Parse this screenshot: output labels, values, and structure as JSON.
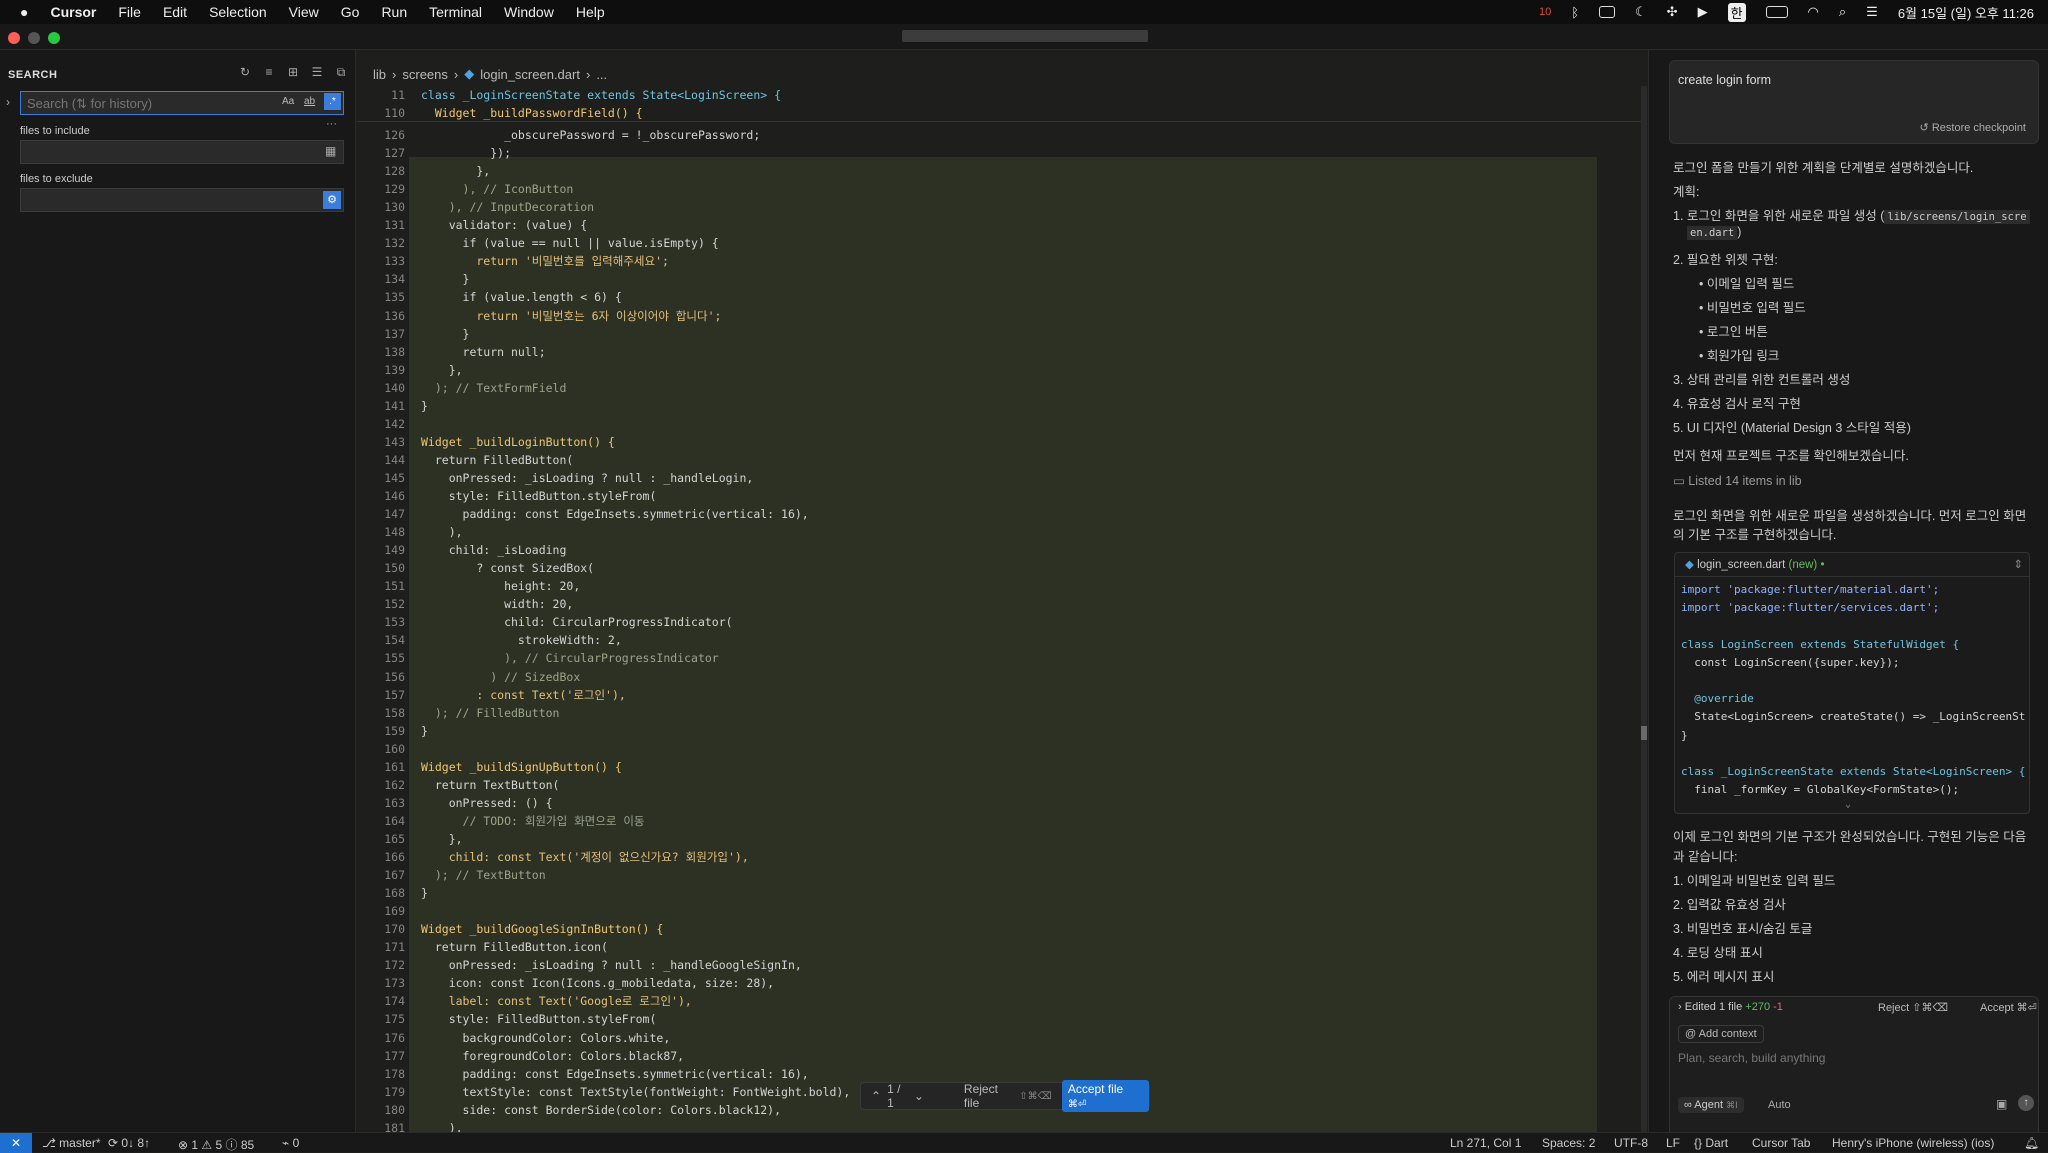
{
  "menubar": {
    "app": "Cursor",
    "items": [
      "File",
      "Edit",
      "Selection",
      "View",
      "Go",
      "Run",
      "Terminal",
      "Window",
      "Help"
    ],
    "clock": "6월 15일 (일) 오후 11:26",
    "input_source": "한",
    "notif_badge": "10"
  },
  "sidebar": {
    "title": "SEARCH",
    "search_placeholder": "Search (⇅ for history)",
    "match_case": "Aa",
    "whole_word": "ab",
    "regex": ".*",
    "include_label": "files to include",
    "exclude_label": "files to exclude",
    "more": "···"
  },
  "editor": {
    "breadcrumb": [
      "lib",
      "screens",
      "login_screen.dart",
      "..."
    ],
    "sticky": [
      {
        "n": "11",
        "t": "class _LoginScreenState extends State<LoginScreen> {"
      },
      {
        "n": "110",
        "t": "  Widget _buildPasswordField() {"
      }
    ],
    "lines": [
      {
        "n": "126",
        "t": "            _obscurePassword = !_obscurePassword;"
      },
      {
        "n": "127",
        "t": "          });"
      },
      {
        "n": "128",
        "t": "        },"
      },
      {
        "n": "129",
        "t": "      ), // IconButton"
      },
      {
        "n": "130",
        "t": "    ), // InputDecoration"
      },
      {
        "n": "131",
        "t": "    validator: (value) {"
      },
      {
        "n": "132",
        "t": "      if (value == null || value.isEmpty) {"
      },
      {
        "n": "133",
        "t": "        return '비밀번호를 입력해주세요';"
      },
      {
        "n": "134",
        "t": "      }"
      },
      {
        "n": "135",
        "t": "      if (value.length < 6) {"
      },
      {
        "n": "136",
        "t": "        return '비밀번호는 6자 이상이어야 합니다';"
      },
      {
        "n": "137",
        "t": "      }"
      },
      {
        "n": "138",
        "t": "      return null;"
      },
      {
        "n": "139",
        "t": "    },"
      },
      {
        "n": "140",
        "t": "  ); // TextFormField"
      },
      {
        "n": "141",
        "t": "}"
      },
      {
        "n": "142",
        "t": ""
      },
      {
        "n": "143",
        "t": "Widget _buildLoginButton() {"
      },
      {
        "n": "144",
        "t": "  return FilledButton("
      },
      {
        "n": "145",
        "t": "    onPressed: _isLoading ? null : _handleLogin,"
      },
      {
        "n": "146",
        "t": "    style: FilledButton.styleFrom("
      },
      {
        "n": "147",
        "t": "      padding: const EdgeInsets.symmetric(vertical: 16),"
      },
      {
        "n": "148",
        "t": "    ),"
      },
      {
        "n": "149",
        "t": "    child: _isLoading"
      },
      {
        "n": "150",
        "t": "        ? const SizedBox("
      },
      {
        "n": "151",
        "t": "            height: 20,"
      },
      {
        "n": "152",
        "t": "            width: 20,"
      },
      {
        "n": "153",
        "t": "            child: CircularProgressIndicator("
      },
      {
        "n": "154",
        "t": "              strokeWidth: 2,"
      },
      {
        "n": "155",
        "t": "            ), // CircularProgressIndicator"
      },
      {
        "n": "156",
        "t": "          ) // SizedBox"
      },
      {
        "n": "157",
        "t": "        : const Text('로그인'),"
      },
      {
        "n": "158",
        "t": "  ); // FilledButton"
      },
      {
        "n": "159",
        "t": "}"
      },
      {
        "n": "160",
        "t": ""
      },
      {
        "n": "161",
        "t": "Widget _buildSignUpButton() {"
      },
      {
        "n": "162",
        "t": "  return TextButton("
      },
      {
        "n": "163",
        "t": "    onPressed: () {"
      },
      {
        "n": "164",
        "t": "      // TODO: 회원가입 화면으로 이동"
      },
      {
        "n": "165",
        "t": "    },"
      },
      {
        "n": "166",
        "t": "    child: const Text('계정이 없으신가요? 회원가입'),"
      },
      {
        "n": "167",
        "t": "  ); // TextButton"
      },
      {
        "n": "168",
        "t": "}"
      },
      {
        "n": "169",
        "t": ""
      },
      {
        "n": "170",
        "t": "Widget _buildGoogleSignInButton() {"
      },
      {
        "n": "171",
        "t": "  return FilledButton.icon("
      },
      {
        "n": "172",
        "t": "    onPressed: _isLoading ? null : _handleGoogleSignIn,"
      },
      {
        "n": "173",
        "t": "    icon: const Icon(Icons.g_mobiledata, size: 28),"
      },
      {
        "n": "174",
        "t": "    label: const Text('Google로 로그인'),"
      },
      {
        "n": "175",
        "t": "    style: FilledButton.styleFrom("
      },
      {
        "n": "176",
        "t": "      backgroundColor: Colors.white,"
      },
      {
        "n": "177",
        "t": "      foregroundColor: Colors.black87,"
      },
      {
        "n": "178",
        "t": "      padding: const EdgeInsets.symmetric(vertical: 16),"
      },
      {
        "n": "179",
        "t": "      textStyle: const TextStyle(fontWeight: FontWeight.bold),"
      },
      {
        "n": "180",
        "t": "      side: const BorderSide(color: Colors.black12),"
      },
      {
        "n": "181",
        "t": "    ),"
      }
    ],
    "diff": {
      "counter": "1 / 1",
      "reject": "Reject file",
      "reject_kbd": "⇧⌘⌫",
      "accept": "Accept file",
      "accept_kbd": "⌘⏎"
    }
  },
  "chat": {
    "user_message": "create login form",
    "restore": "Restore checkpoint",
    "intro": "로그인 폼을 만들기 위한 계획을 단계별로 설명하겠습니다.",
    "plan_label": "계획:",
    "plan": [
      {
        "n": "1.",
        "t": "로그인 화면을 위한 새로운 파일 생성 (",
        "code": "lib/screens/login_scre",
        "cont": "en.dart",
        ")": ")"
      },
      {
        "n": "2.",
        "t": "필요한 위젯 구현:"
      },
      {
        "n": "3.",
        "t": "상태 관리를 위한 컨트롤러 생성"
      },
      {
        "n": "4.",
        "t": "유효성 검사 로직 구현"
      },
      {
        "n": "5.",
        "t": "UI 디자인 (Material Design 3 스타일 적용)"
      }
    ],
    "widgets": [
      "이메일 입력 필드",
      "비밀번호 입력 필드",
      "로그인 버튼",
      "회원가입 링크"
    ],
    "check_structure": "먼저 현재 프로젝트 구조를 확인해보겠습니다.",
    "listed": "Listed 14 items in lib",
    "create_msg_1": "로그인 화면을 위한 새로운 파일을 생성하겠습니다. 먼저 로그인 화면",
    "create_msg_2": "의 기본 구조를 구현하겠습니다.",
    "file_header": {
      "name": "login_screen.dart",
      "tag": "(new)",
      "dot": "•"
    },
    "code": [
      "import 'package:flutter/material.dart';",
      "import 'package:flutter/services.dart';",
      "",
      "class LoginScreen extends StatefulWidget {",
      "  const LoginScreen({super.key});",
      "",
      "  @override",
      "  State<LoginScreen> createState() => _LoginScreenSt",
      "}",
      "",
      "class _LoginScreenState extends State<LoginScreen> {",
      "  final _formKey = GlobalKey<FormState>();"
    ],
    "done_1": "이제 로그인 화면의 기본 구조가 완성되었습니다. 구현된 기능은 다음",
    "done_2": "과 같습니다:",
    "features": [
      "1. 이메일과 비밀번호 입력 필드",
      "2. 입력값 유효성 검사",
      "3. 비밀번호 표시/숨김 토글",
      "4. 로딩 상태 표시",
      "5. 에러 메시지 표시"
    ],
    "edited": "Edited 1 file",
    "added": "+270",
    "removed": "-1",
    "reject": "Reject ⇧⌘⌫",
    "accept": "Accept ⌘⏎",
    "add_context": "Add context",
    "placeholder": "Plan, search, build anything",
    "mode": "Agent",
    "mode_kbd": "⌘I",
    "model": "Auto"
  },
  "status": {
    "branch": "master*",
    "sync": "0↓ 8↑",
    "errors": "1",
    "warnings": "5",
    "info": "85",
    "ports": "0",
    "position": "Ln 271, Col 1",
    "spaces": "Spaces: 2",
    "encoding": "UTF-8",
    "eol": "LF",
    "language": "Dart",
    "tab": "Cursor Tab",
    "device": "Henry's iPhone (wireless) (ios)"
  }
}
